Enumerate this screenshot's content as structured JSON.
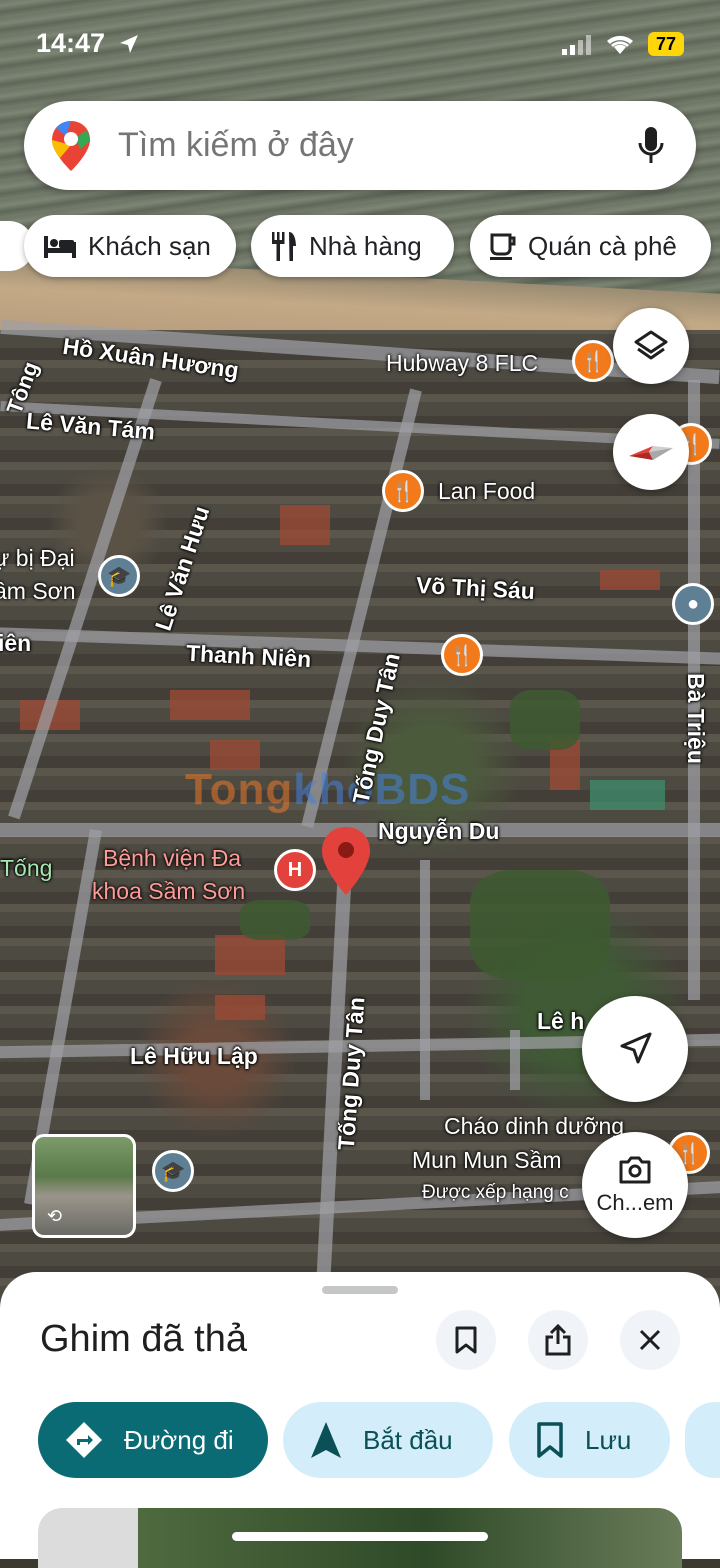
{
  "status_bar": {
    "time": "14:47",
    "battery": "77"
  },
  "search": {
    "placeholder": "Tìm kiếm ở đây"
  },
  "chips": [
    {
      "label": "Khách sạn",
      "icon": "bed-icon"
    },
    {
      "label": "Nhà hàng",
      "icon": "restaurant-icon"
    },
    {
      "label": "Quán cà phê",
      "icon": "coffee-icon"
    }
  ],
  "map": {
    "roads": {
      "ho_xuan_huong": "Hồ Xuân Hương",
      "le_van_tam": "Lê Văn Tám",
      "le_van_huu": "Lê Văn Hưu",
      "vo_thi_sau": "Võ Thị Sáu",
      "thanh_nien": "Thanh Niên",
      "thanh_nien_left": "iên",
      "tong_duy_tan_1": "Tống Duy Tân",
      "tong_duy_tan_2": "Tống Duy Tân",
      "nguyen_du": "Nguyễn Du",
      "ba_trieu": "Bà Triệu",
      "le_huu_lap": "Lê Hữu Lập",
      "tong_left": "Tông",
      "tong_left2": "Tống",
      "le_partial": "Lê h"
    },
    "pois": {
      "hubway": "Hubway 8 FLC",
      "lan_food": "Lan Food",
      "school_1": "ự bị Đại",
      "school_2": "ầm Sơn",
      "hospital_1": "Bệnh viện Đa",
      "hospital_2": "khoa Sầm Sơn",
      "chao_1": "Cháo dinh dưỡng",
      "chao_2": "Mun Mun Sầm",
      "chao_3": "Được xếp hạng c"
    },
    "watermark": {
      "part1": "Tong",
      "part2": "khoBDS"
    },
    "camera_label": "Ch...em"
  },
  "sheet": {
    "title": "Ghim đã thả",
    "actions": [
      {
        "label": "Đường đi",
        "icon": "directions-icon"
      },
      {
        "label": "Bắt đầu",
        "icon": "navigation-arrow-icon"
      },
      {
        "label": "Lưu",
        "icon": "bookmark-icon"
      }
    ]
  },
  "colors": {
    "accent_teal": "#0b6b75",
    "chip_light": "#d3eefa",
    "poi_orange": "#f27a1a",
    "pin_red": "#e2423b"
  }
}
